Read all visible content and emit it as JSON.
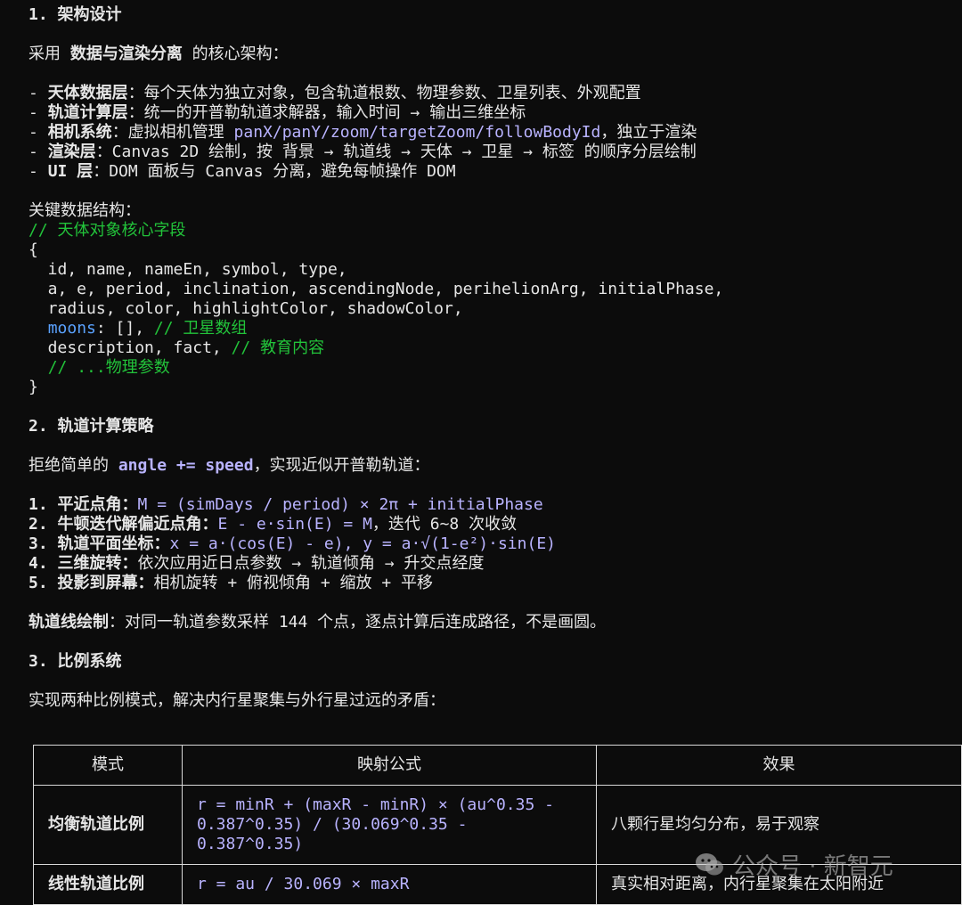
{
  "section1": {
    "heading": "1. 架构设计",
    "intro_prefix": "采用 ",
    "intro_bold": "数据与渲染分离",
    "intro_suffix": " 的核心架构：",
    "layers": [
      {
        "prefix": "- ",
        "name": "天体数据层",
        "desc": "：每个天体为独立对象，包含轨道根数、物理参数、卫星列表、外观配置"
      },
      {
        "prefix": "- ",
        "name": "轨道计算层",
        "desc": "：统一的开普勒轨道求解器，输入时间 → 输出三维坐标"
      },
      {
        "prefix": "- ",
        "name": "相机系统",
        "desc": "：虚拟相机管理 ",
        "code": "panX/panY/zoom/targetZoom/followBodyId",
        "tail": "，独立于渲染"
      },
      {
        "prefix": "- ",
        "name": "渲染层",
        "desc": "：Canvas 2D 绘制，按 背景 → 轨道线 → 天体 → 卫星 → 标签 的顺序分层绘制"
      },
      {
        "prefix": "- ",
        "name": "UI 层",
        "desc": "：DOM 面板与 Canvas 分离，避免每帧操作 DOM"
      }
    ],
    "struct_heading": "关键数据结构：",
    "code": {
      "comment1": "// 天体对象核心字段",
      "open": "{",
      "line1": "  id, name, nameEn, symbol, type,",
      "line2": "  a, e, period, inclination, ascendingNode, perihelionArg, initialPhase,",
      "line3": "  radius, color, highlightColor, shadowColor,",
      "moons_key": "moons",
      "moons_val": ": [], ",
      "moons_comment": "// 卫星数组",
      "line5_pre": "  description, fact, ",
      "line5_comment": "// 教育内容",
      "line6_comment": "// ...物理参数",
      "close": "}"
    }
  },
  "section2": {
    "heading": "2. 轨道计算策略",
    "intro_prefix": "拒绝简单的 ",
    "intro_code": "angle += speed",
    "intro_suffix": "，实现近似开普勒轨道：",
    "steps": [
      {
        "label": "1. 平近点角：",
        "formula": "M = (simDays / period) × 2π + initialPhase",
        "tail": ""
      },
      {
        "label": "2. 牛顿迭代解偏近点角：",
        "formula": "E - e·sin(E) = M",
        "tail": "，迭代 6~8 次收敛"
      },
      {
        "label": "3. 轨道平面坐标：",
        "formula": "x = a·(cos(E) - e), y = a·√(1-e²)·sin(E)",
        "tail": ""
      },
      {
        "label": "4. 三维旋转：",
        "formula": "",
        "tail": "依次应用近日点参数 → 轨道倾角 → 升交点经度"
      },
      {
        "label": "5. 投影到屏幕：",
        "formula": "",
        "tail": "相机旋转 + 俯视倾角 + 缩放 + 平移"
      }
    ],
    "orbit_label": "轨道线绘制",
    "orbit_desc": "：对同一轨道参数采样 144 个点，逐点计算后连成路径，不是画圆。"
  },
  "section3": {
    "heading": "3. 比例系统",
    "intro": "实现两种比例模式，解决内行星聚集与外行星过远的矛盾：",
    "table": {
      "headers": [
        "模式",
        "映射公式",
        "效果"
      ],
      "rows": [
        {
          "mode": "均衡轨道比例",
          "formula_lines": [
            "r = minR + (maxR - minR) × (au^0.35 -",
            "0.387^0.35) / (30.069^0.35 -",
            "0.387^0.35)"
          ],
          "effect": "八颗行星均匀分布，易于观察"
        },
        {
          "mode": "线性轨道比例",
          "formula_lines": [
            "r = au / 30.069 × maxR"
          ],
          "effect": "真实相对距离，内行星聚集在太阳附近"
        }
      ]
    }
  },
  "watermark": {
    "icon": "wechat-icon",
    "text": "公众号 · 新智元"
  }
}
